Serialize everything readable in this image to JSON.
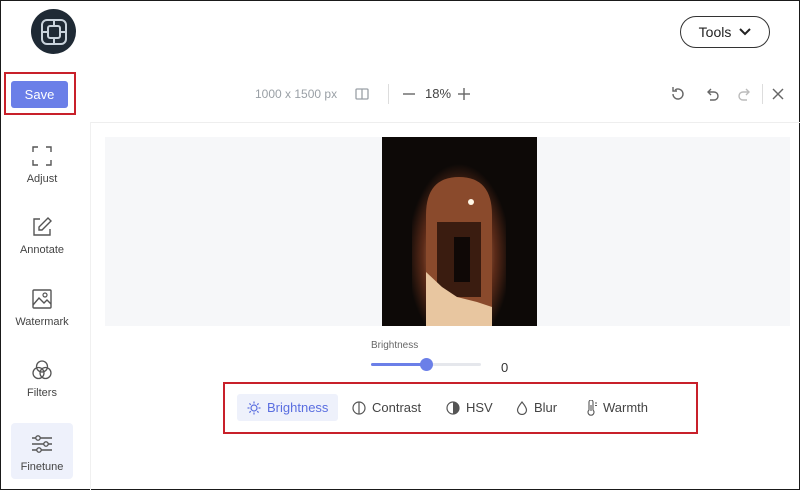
{
  "header": {
    "logo_icon": "frame-logo-icon",
    "tools_label": "Tools"
  },
  "toolbar": {
    "save_label": "Save",
    "dimensions": "1000 x 1500 px",
    "zoom": "18%"
  },
  "sidebar": {
    "items": [
      {
        "label": "Adjust",
        "icon": "crop-frame-icon",
        "active": false
      },
      {
        "label": "Annotate",
        "icon": "pencil-box-icon",
        "active": false
      },
      {
        "label": "Watermark",
        "icon": "image-icon",
        "active": false
      },
      {
        "label": "Filters",
        "icon": "overlapping-circles-icon",
        "active": false
      },
      {
        "label": "Finetune",
        "icon": "sliders-icon",
        "active": true
      }
    ]
  },
  "slider": {
    "label": "Brightness",
    "value": "0",
    "fraction": 0.5
  },
  "tabs": [
    {
      "label": "Brightness",
      "icon": "sun-icon",
      "active": true
    },
    {
      "label": "Contrast",
      "icon": "contrast-icon",
      "active": false
    },
    {
      "label": "HSV",
      "icon": "half-circle-icon",
      "active": false
    },
    {
      "label": "Blur",
      "icon": "droplet-icon",
      "active": false
    },
    {
      "label": "Warmth",
      "icon": "thermometer-icon",
      "active": false
    }
  ],
  "colors": {
    "accent": "#6b7fe8",
    "highlight": "#c8202a"
  }
}
